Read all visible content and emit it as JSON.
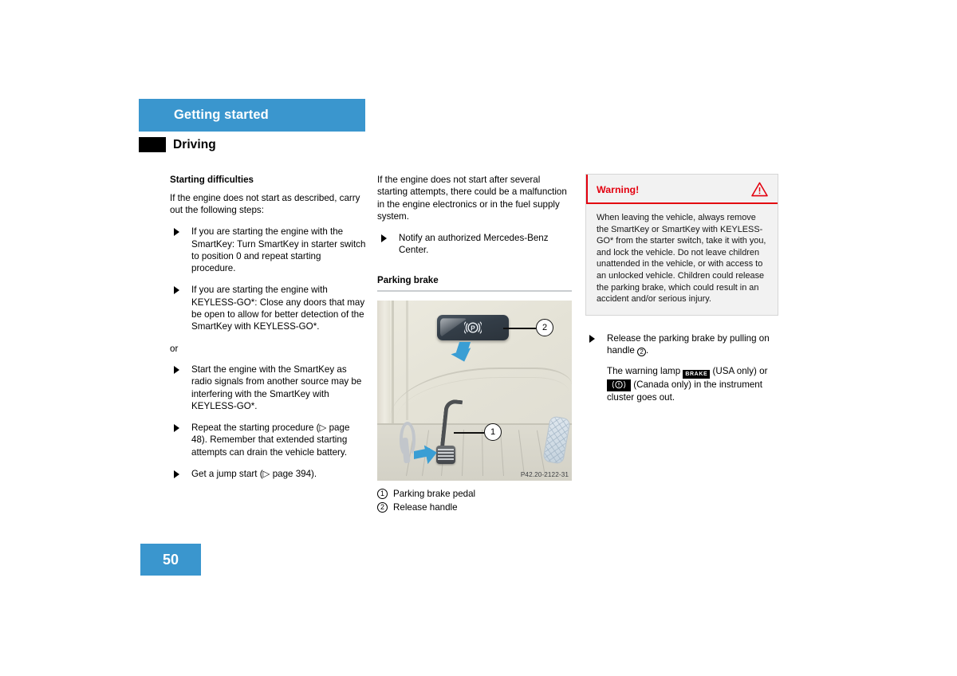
{
  "header": {
    "chapter": "Getting started",
    "section": "Driving"
  },
  "footer": {
    "page_number": "50"
  },
  "colors": {
    "accent_blue": "#3a96ce",
    "warning_red": "#e3000f",
    "rule_gray": "#c9cdd0"
  },
  "left_column": {
    "heading": "Starting difficulties",
    "intro": "If the engine does not start as described, carry out the following steps:",
    "bullets": [
      "If you are starting the engine with the SmartKey: Turn SmartKey in starter switch to position 0 and repeat starting procedure.",
      "If you are starting the engine with KEYLESS-GO*: Close any doors that may be open to allow for better detection of the SmartKey with KEYLESS-GO*."
    ],
    "or_label": "or",
    "bullets2": [
      "Start the engine with the SmartKey as radio signals from another source may be interfering with the SmartKey with KEYLESS-GO*.",
      "Repeat the starting procedure (▷ page 48). Remember that extended starting attempts can drain the vehicle battery.",
      "Get a jump start (▷ page 394)."
    ]
  },
  "middle_column": {
    "intro": "If the engine does not start after several starting attempts, there could be a malfunction in the engine electronics or in the fuel supply system.",
    "bullets": [
      "Notify an authorized Mercedes-Benz Center."
    ],
    "heading": "Parking brake",
    "figure": {
      "code": "P42.20-2122-31",
      "callout_1": "1",
      "callout_2": "2",
      "switch_glyph": "(P)"
    },
    "caption": [
      {
        "num": "1",
        "text": "Parking brake pedal"
      },
      {
        "num": "2",
        "text": "Release handle"
      }
    ]
  },
  "right_column": {
    "warning": {
      "title": "Warning!",
      "icon": "warning-triangle-icon",
      "body": "When leaving the vehicle, always remove the SmartKey or SmartKey with KEYLESS-GO* from the starter switch, take it with you, and lock the vehicle. Do not leave children unattended in the vehicle, or with access to an unlocked vehicle. Children could release the parking brake, which could result in an accident and/or serious injury."
    },
    "bullet": {
      "prefix": "Release the parking brake by pulling on handle ",
      "ref_num": "2",
      "suffix": "."
    },
    "note": {
      "part1": "The warning lamp ",
      "lamp_usa": "BRAKE",
      "part2": " (USA only) or",
      "lamp_canada_symbol": "!",
      "part3": " (Canada only) in the instrument cluster goes out."
    }
  }
}
